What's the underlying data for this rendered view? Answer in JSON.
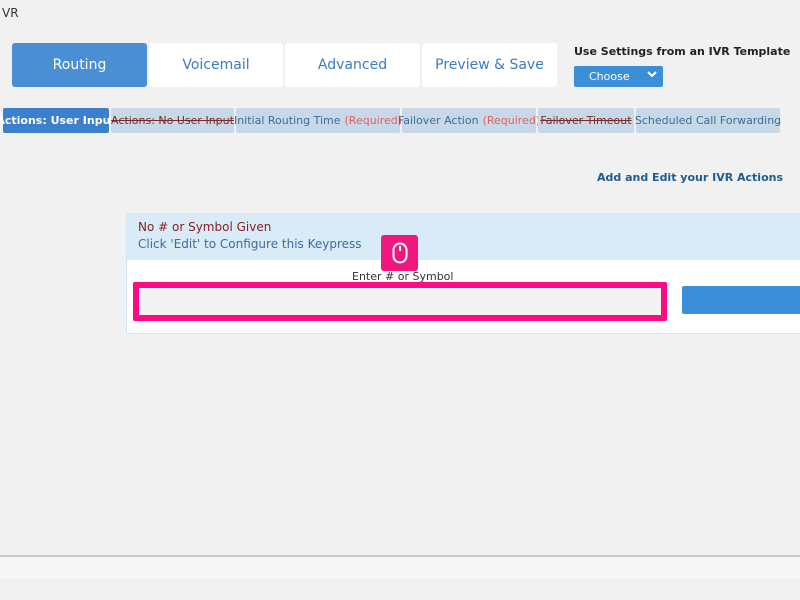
{
  "page": {
    "title": "VR"
  },
  "main_tabs": [
    {
      "label": "Routing",
      "active": true
    },
    {
      "label": "Voicemail"
    },
    {
      "label": "Advanced"
    },
    {
      "label": "Preview & Save"
    }
  ],
  "template": {
    "label": "Use Settings from an IVR Template",
    "selected": "Choose",
    "icon": "chevron-down-icon"
  },
  "sub_tabs": [
    {
      "label": "Actions: User Input",
      "active": true
    },
    {
      "label": "Actions: No User Input",
      "struck": true
    },
    {
      "label": "Initial Routing Time",
      "required": "(Required)"
    },
    {
      "label": "Failover Action",
      "required": "(Required)"
    },
    {
      "label": "Failover Timeout",
      "struck": true
    },
    {
      "label": "Scheduled Call Forwarding"
    }
  ],
  "ivr_link": "Add and Edit your IVR Actions",
  "keypress_panel": {
    "title": "No # or Symbol Given",
    "subtitle": "Click 'Edit' to Configure this Keypress",
    "field_label": "Enter # or Symbol",
    "input_value": "",
    "input_placeholder": ""
  },
  "icons": {
    "mouse": "mouse-icon"
  },
  "colors": {
    "accent": "#4a8fd4",
    "highlight": "#ff0a82",
    "required": "#e26060"
  }
}
